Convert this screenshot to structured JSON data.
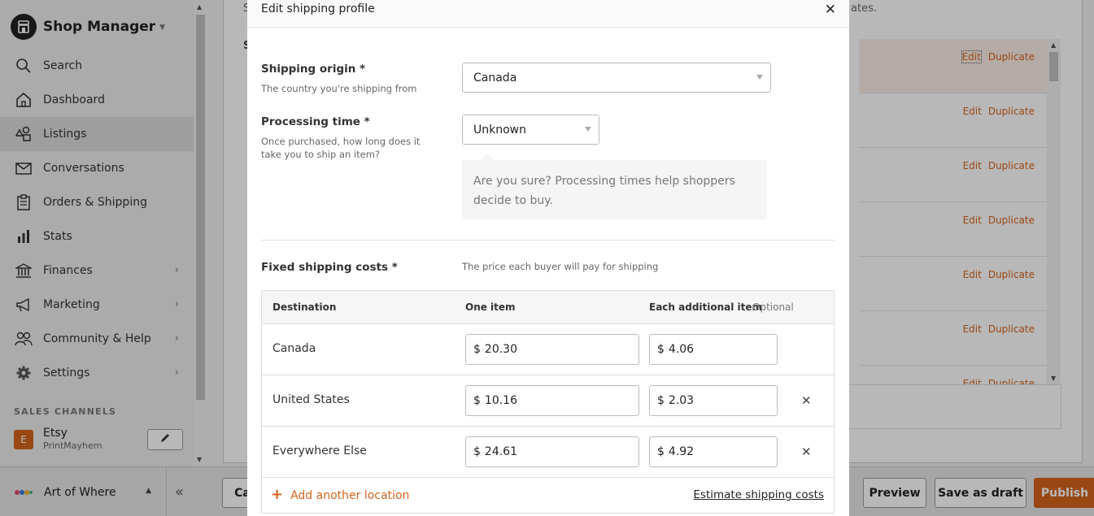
{
  "app": {
    "title": "Shop Manager"
  },
  "sidebar": {
    "nav": [
      {
        "label": "Search",
        "icon": "search-icon"
      },
      {
        "label": "Dashboard",
        "icon": "home-icon"
      },
      {
        "label": "Listings",
        "icon": "shapes-icon",
        "active": true
      },
      {
        "label": "Conversations",
        "icon": "mail-icon"
      },
      {
        "label": "Orders & Shipping",
        "icon": "clipboard-icon"
      },
      {
        "label": "Stats",
        "icon": "bar-chart-icon"
      },
      {
        "label": "Finances",
        "icon": "bank-icon",
        "chevron": true
      },
      {
        "label": "Marketing",
        "icon": "megaphone-icon",
        "chevron": true
      },
      {
        "label": "Community & Help",
        "icon": "people-icon",
        "chevron": true
      },
      {
        "label": "Settings",
        "icon": "gear-icon",
        "chevron": true
      }
    ],
    "sales_channels_title": "SALES CHANNELS",
    "channel": {
      "badge": "E",
      "name": "Etsy",
      "shop": "PrintMayhem"
    }
  },
  "bottom_bar": {
    "app_switcher": "Art of Where",
    "cancel_label": "Ca",
    "preview_label": "Preview",
    "save_draft_label": "Save as draft",
    "publish_label": "Publish"
  },
  "background": {
    "hint_left": "S",
    "hint_right": "ates.",
    "section_letter": "S",
    "rows": [
      {
        "edit": "Edit",
        "duplicate": "Duplicate"
      },
      {
        "edit": "Edit",
        "duplicate": "Duplicate"
      },
      {
        "edit": "Edit",
        "duplicate": "Duplicate"
      },
      {
        "edit": "Edit",
        "duplicate": "Duplicate"
      },
      {
        "edit": "Edit",
        "duplicate": "Duplicate"
      },
      {
        "edit": "Edit",
        "duplicate": "Duplicate"
      },
      {
        "edit": "Edit",
        "duplicate": "Duplicate"
      }
    ]
  },
  "modal": {
    "title": "Edit shipping profile",
    "origin": {
      "label": "Shipping origin *",
      "help": "The country you're shipping from",
      "value": "Canada"
    },
    "processing": {
      "label": "Processing time *",
      "help": "Once purchased, how long does it take you to ship an item?",
      "value": "Unknown",
      "warning": "Are you sure? Processing times help shoppers decide to buy."
    },
    "fixed": {
      "label": "Fixed shipping costs *",
      "help": "The price each buyer will pay for shipping"
    },
    "table": {
      "headers": {
        "destination": "Destination",
        "one_item": "One item",
        "each_additional": "Each additional item",
        "optional": "Optional"
      },
      "currency": "$",
      "rows": [
        {
          "destination": "Canada",
          "one_item": "20.30",
          "additional": "4.06",
          "removable": false
        },
        {
          "destination": "United States",
          "one_item": "10.16",
          "additional": "2.03",
          "removable": true
        },
        {
          "destination": "Everywhere Else",
          "one_item": "24.61",
          "additional": "4.92",
          "removable": true
        }
      ],
      "add_location": "Add another location",
      "estimate": "Estimate shipping costs"
    }
  }
}
